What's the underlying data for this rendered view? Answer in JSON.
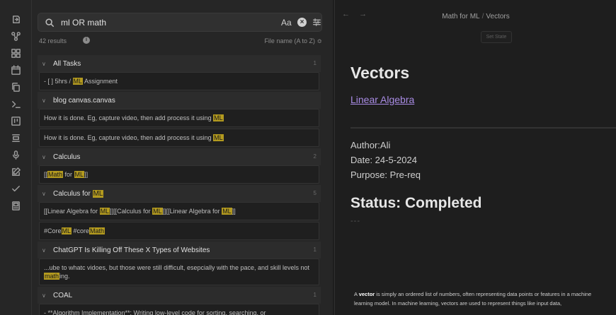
{
  "ribbon": {
    "icons": [
      "open-vault-icon",
      "graph-view-icon",
      "grid-icon",
      "calendar-icon",
      "copy-icon",
      "terminal-icon",
      "kanban-icon",
      "stack-icon",
      "microphone-icon",
      "edit-icon",
      "check-icon",
      "template-icon"
    ]
  },
  "search": {
    "query": "ml OR math",
    "match_case_label": "Aa",
    "clear_label": "×",
    "results_count": "42 results",
    "sort_label": "File name (A to Z) ≎"
  },
  "groups": [
    {
      "title_parts": [
        {
          "text": "All Tasks",
          "hl": false
        }
      ],
      "count": "1",
      "matches": [
        [
          {
            "text": "- [ ] 5hrs / ",
            "hl": false
          },
          {
            "text": "ML",
            "hl": true
          },
          {
            "text": " Assignment",
            "hl": false
          }
        ]
      ]
    },
    {
      "title_parts": [
        {
          "text": "blog canvas.canvas",
          "hl": false
        }
      ],
      "count": "",
      "matches": [
        [
          {
            "text": "How it is done. Eg, capture video, then add process it using ",
            "hl": false
          },
          {
            "text": "ML",
            "hl": true
          }
        ],
        [
          {
            "text": "How it is done. Eg, capture video, then add process it using ",
            "hl": false
          },
          {
            "text": "ML",
            "hl": true
          }
        ]
      ]
    },
    {
      "title_parts": [
        {
          "text": "Calculus",
          "hl": false
        }
      ],
      "count": "2",
      "matches": [
        [
          {
            "text": "[[",
            "hl": false
          },
          {
            "text": "Math",
            "hl": true
          },
          {
            "text": " for ",
            "hl": false
          },
          {
            "text": "ML",
            "hl": true
          },
          {
            "text": "]]",
            "hl": false
          }
        ]
      ]
    },
    {
      "title_parts": [
        {
          "text": "Calculus for ",
          "hl": false
        },
        {
          "text": "ML",
          "hl": true
        }
      ],
      "count": "5",
      "matches": [
        [
          {
            "text": "[[Linear Algebra for ",
            "hl": false
          },
          {
            "text": "ML",
            "hl": true
          },
          {
            "text": "]][[Calculus for ",
            "hl": false
          },
          {
            "text": "ML",
            "hl": true
          },
          {
            "text": "]][[Linear Algebra for ",
            "hl": false
          },
          {
            "text": "ML",
            "hl": true
          },
          {
            "text": "]]",
            "hl": false
          }
        ],
        [
          {
            "text": "#Core",
            "hl": false
          },
          {
            "text": "ML",
            "hl": true
          },
          {
            "text": " #core",
            "hl": false
          },
          {
            "text": "Math",
            "hl": true
          }
        ]
      ]
    },
    {
      "title_parts": [
        {
          "text": "ChatGPT Is Killing Off These X Types of Websites",
          "hl": false
        }
      ],
      "count": "1",
      "matches": [
        [
          {
            "text": "...ube to whatc vidoes, but those were still difficult, esepcially with the pace, and skill levels not ",
            "hl": false
          },
          {
            "text": "math",
            "hl": true
          },
          {
            "text": "ing.",
            "hl": false
          }
        ]
      ]
    },
    {
      "title_parts": [
        {
          "text": "COAL",
          "hl": false
        }
      ],
      "count": "1",
      "matches": [
        [
          {
            "text": "- **Algorithm Implementation**: Writing low-level code for sorting, searching, or",
            "hl": false
          }
        ]
      ]
    }
  ],
  "editor": {
    "back": "←",
    "forward": "→",
    "breadcrumb_folder": "Math for ML",
    "breadcrumb_sep": "/",
    "breadcrumb_file": "Vectors",
    "set_state_label": "Set State",
    "title": "Vectors",
    "link": "Linear Algebra",
    "author": "Author:Ali",
    "date": "Date: 24-5-2024",
    "purpose": "Purpose: Pre-req",
    "status": "Status: Completed",
    "dashes": "---",
    "para_prefix": "A ",
    "para_bold": "vector",
    "para_rest": " is simply an ordered list of numbers, often representing data points or features in a machine learning model. In machine learning, vectors are used to represent things like input data,"
  }
}
